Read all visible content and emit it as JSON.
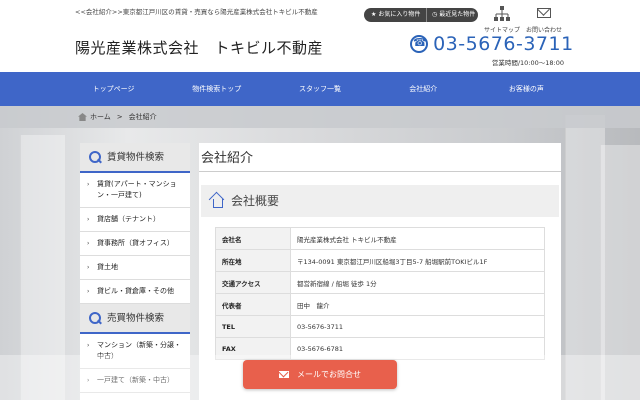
{
  "header": {
    "topline": "<<会社紹介>>東京都江戸川区の賃貸・売買なら陽光産業株式会社トキビル不動産",
    "site_title": "陽光産業株式会社　トキビル不動産",
    "favorites_label": "お気に入り物件",
    "recent_label": "最近見た物件",
    "sitemap_label": "サイトマップ",
    "contact_label": "お問い合わせ",
    "phone": "03-5676-3711",
    "hours": "営業時間/10:00～18:00"
  },
  "nav": {
    "items": [
      "トップページ",
      "物件検索トップ",
      "スタッフ一覧",
      "会社紹介",
      "お客様の声"
    ]
  },
  "breadcrumb": {
    "home": "ホーム",
    "sep": ">",
    "current": "会社紹介"
  },
  "sidebar": {
    "rental_heading": "賃貸物件検索",
    "rental_items": [
      "賃貸(アパート・マンション・一戸建て)",
      "貸店舗（テナント）",
      "貸事務所（貸オフィス）",
      "貸土地",
      "貸ビル・貸倉庫・その他"
    ],
    "sale_heading": "売買物件検索",
    "sale_items": [
      "マンション（新築・分譲・中古）",
      "一戸建て（新築・中古）"
    ]
  },
  "main": {
    "page_title": "会社紹介",
    "section_title": "会社概要",
    "rows": [
      {
        "key": "会社名",
        "value": "陽光産業株式会社 トキビル不動産"
      },
      {
        "key": "所在地",
        "value": "〒134-0091 東京都江戸川区船堀3丁目5-7 船堀駅前TOKIビル1F"
      },
      {
        "key": "交通アクセス",
        "value": "都営新宿線 / 船堀 徒歩 1分"
      },
      {
        "key": "代表者",
        "value": "田中　龍介"
      },
      {
        "key": "TEL",
        "value": "03-5676-3711"
      },
      {
        "key": "FAX",
        "value": "03-5676-6781"
      }
    ]
  },
  "contact_button": {
    "label": "メールでお問合せ"
  },
  "colors": {
    "nav": "#3f66c8",
    "phone": "#2b63b8",
    "contact": "#e8604c"
  }
}
